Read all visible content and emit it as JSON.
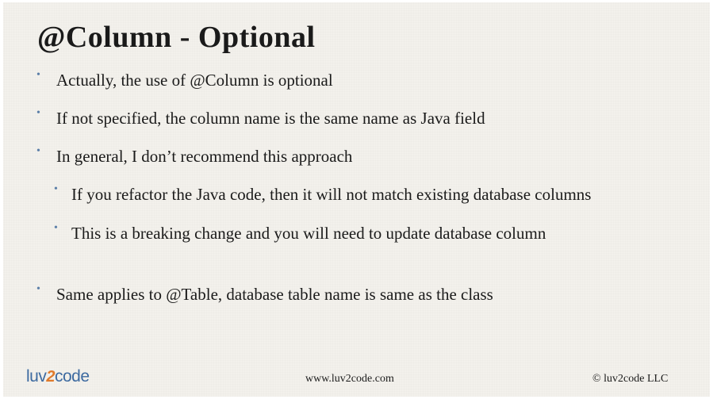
{
  "title": "@Column - Optional",
  "bullets": [
    "Actually, the use of @Column is optional",
    "If not specified, the column name is the same name as Java field",
    "In general, I don’t recommend this approach"
  ],
  "sub_bullets": [
    "If you refactor the Java code, then it will not match existing database columns",
    "This is a breaking change and you will need to update database column"
  ],
  "final_bullet": "Same applies to @Table, database table name is same as the class",
  "bullet_glyph": "•",
  "footer": {
    "logo_text_prefix": "luv",
    "logo_text_digit": "2",
    "logo_text_suffix": "code",
    "url": "www.luv2code.com",
    "copyright": "© luv2code LLC"
  },
  "colors": {
    "background": "#f3f1ec",
    "text": "#1a1a1a",
    "bullet": "#5a7ea8",
    "logo_blue": "#3d6aa0",
    "logo_orange": "#e07a2b"
  }
}
